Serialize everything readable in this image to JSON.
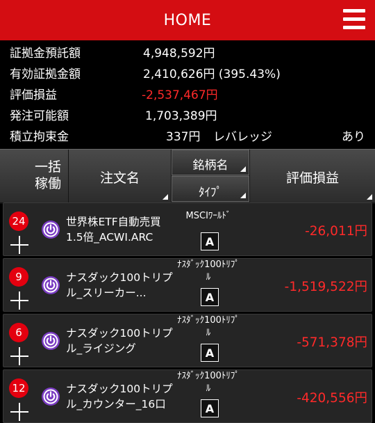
{
  "header": {
    "title": "HOME",
    "menu_icon": "hamburger-menu-icon",
    "color": "#d40d12"
  },
  "summary": {
    "margin_label": "証拠金預託額",
    "margin_value": "4,948,592円",
    "effective_label": "有効証拠金額",
    "effective_value": "2,410,626円 (395.43%)",
    "pnl_label": "評価損益",
    "pnl_value": "-2,537,467円",
    "orderable_label": "発注可能額",
    "orderable_value": "1,703,389円",
    "reserve_label": "積立拘束金",
    "reserve_value": "337円",
    "leverage_label": "レバレッジ",
    "leverage_value": "あり"
  },
  "columns": {
    "bulk_line1": "一括",
    "bulk_line2": "稼働",
    "order_name": "注文名",
    "brand": "銘柄名",
    "type": "ﾀｲﾌﾟ",
    "pnl": "評価損益"
  },
  "orders": [
    {
      "count": "24",
      "name_line1": "世界株ETF自動売買",
      "name_line2": "1.5倍_ACWI.ARC",
      "brand_line1": "MSCIﾜｰﾙﾄﾞ",
      "brand_line2": "",
      "type": "A",
      "pnl": "-26,011円"
    },
    {
      "count": "9",
      "name_line1": "ナスダック100トリプ",
      "name_line2": "ル_スリーカー...",
      "brand_line1": "ﾅｽﾀﾞｯｸ100ﾄﾘﾌﾟ",
      "brand_line2": "ﾙ",
      "type": "A",
      "pnl": "-1,519,522円"
    },
    {
      "count": "6",
      "name_line1": "ナスダック100トリプ",
      "name_line2": "ル_ライジング",
      "brand_line1": "ﾅｽﾀﾞｯｸ100ﾄﾘﾌﾟ",
      "brand_line2": "ﾙ",
      "type": "A",
      "pnl": "-571,378円"
    },
    {
      "count": "12",
      "name_line1": "ナスダック100トリプ",
      "name_line2": "ル_カウンター_16口",
      "brand_line1": "ﾅｽﾀﾞｯｸ100ﾄﾘﾌﾟ",
      "brand_line2": "ﾙ",
      "type": "A",
      "pnl": "-420,556円"
    }
  ],
  "colors": {
    "negative": "#ff2a2a",
    "badge": "#e3000f",
    "power": "#7a3cc2"
  }
}
